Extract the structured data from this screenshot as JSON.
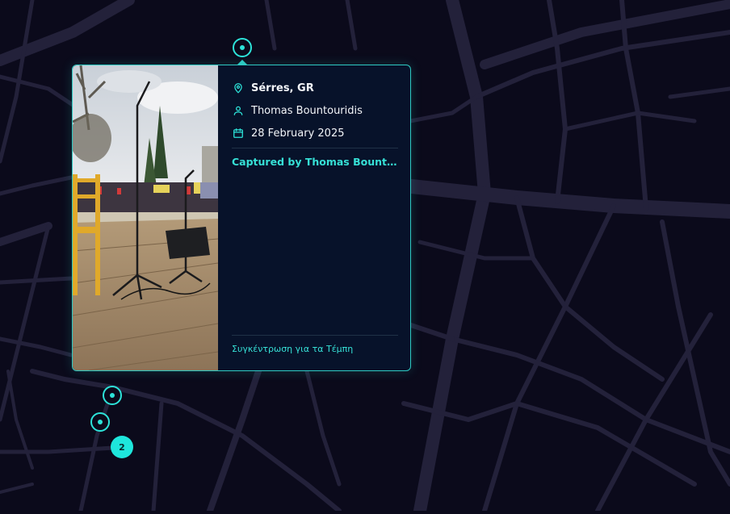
{
  "popup": {
    "location": "Sérres, GR",
    "author": "Thomas Bountouridis",
    "date": "28 February 2025",
    "credit": "Captured by Thomas Bountouridis",
    "caption": "Συγκέντρωση για τα Τέμπη",
    "icons": {
      "location": "map-pin-icon",
      "author": "user-icon",
      "date": "calendar-icon"
    }
  },
  "cluster": {
    "count": "2"
  },
  "colors": {
    "background": "#0b0a1b",
    "roads": "#2a2840",
    "accent": "#2de3d9",
    "popup_bg": "#07122a"
  }
}
